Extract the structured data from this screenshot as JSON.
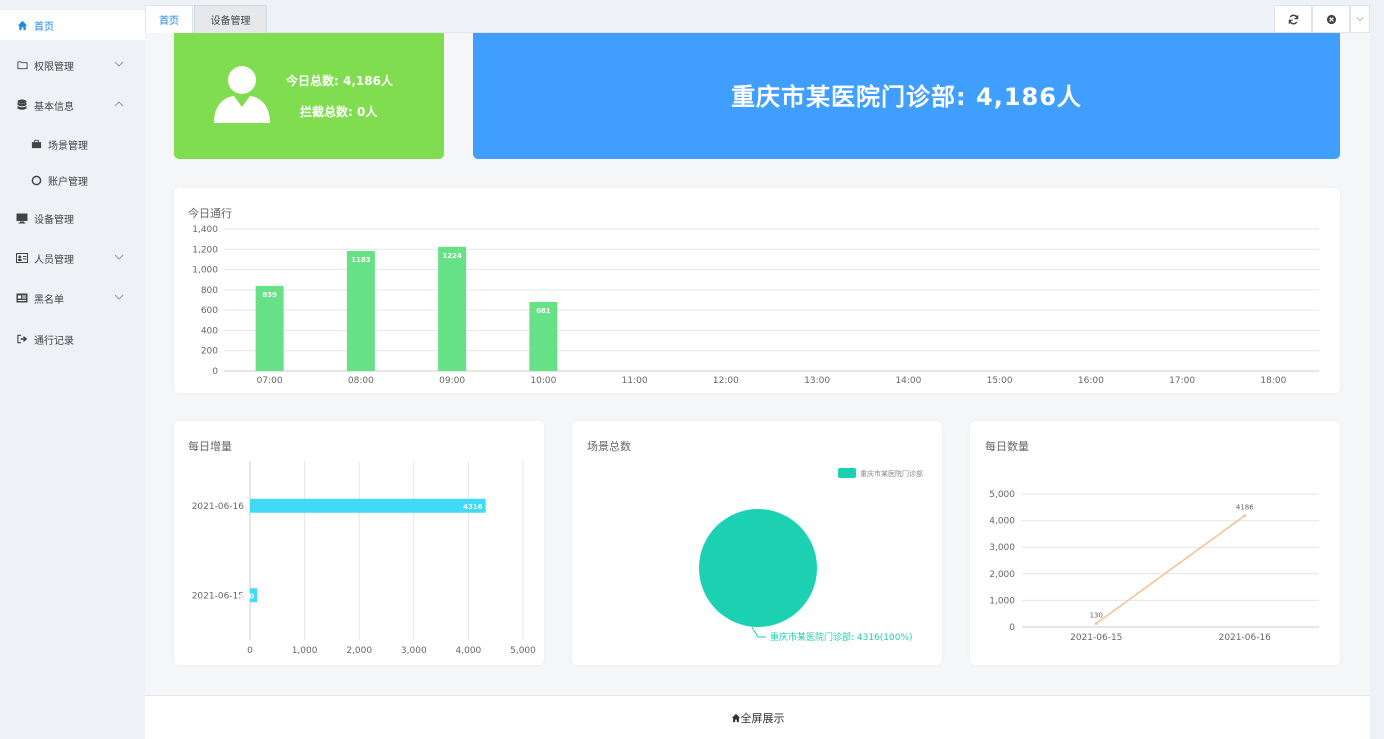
{
  "sidebar": {
    "items": [
      {
        "label": "首页",
        "icon": "home-icon",
        "active": true
      },
      {
        "label": "权限管理",
        "icon": "folder-icon",
        "expandable": true
      },
      {
        "label": "基本信息",
        "icon": "database-icon",
        "expanded": true
      },
      {
        "label": "场景管理",
        "icon": "briefcase-icon",
        "sub": true
      },
      {
        "label": "账户管理",
        "icon": "circle-icon",
        "sub": true
      },
      {
        "label": "设备管理",
        "icon": "monitor-icon"
      },
      {
        "label": "人员管理",
        "icon": "id-card-icon",
        "expandable": true
      },
      {
        "label": "黑名单",
        "icon": "list-card-icon",
        "expandable": true
      },
      {
        "label": "通行记录",
        "icon": "sign-out-icon"
      }
    ]
  },
  "tabs": [
    {
      "label": "首页",
      "active": true
    },
    {
      "label": "设备管理"
    }
  ],
  "stats": {
    "today_total": "今日总数:  4,186人",
    "blocked_total": "拦截总数:  0人",
    "headline": "重庆市某医院门诊部:  4,186人"
  },
  "colors": {
    "green": "#80dd50",
    "blue": "#409eff",
    "bar_green": "#67e186",
    "bar_cyan": "#40d9f7",
    "pie_teal": "#1bd1b1",
    "line_orange": "#f2c28e"
  },
  "footer": {
    "label": "全屏展示",
    "icon": "home-icon"
  },
  "chart_data": [
    {
      "type": "bar",
      "title": "今日通行",
      "categories": [
        "07:00",
        "08:00",
        "09:00",
        "10:00",
        "11:00",
        "12:00",
        "13:00",
        "14:00",
        "15:00",
        "16:00",
        "17:00",
        "18:00"
      ],
      "values": [
        839,
        1183,
        1224,
        681,
        null,
        null,
        null,
        null,
        null,
        null,
        null,
        null
      ],
      "yticks": [
        "0",
        "200",
        "400",
        "600",
        "800",
        "1,000",
        "1,200",
        "1,400"
      ],
      "ylim": [
        0,
        1400
      ],
      "grid": true
    },
    {
      "type": "bar",
      "orientation": "horizontal",
      "title": "每日增量",
      "categories": [
        "2021-06-16",
        "2021-06-15"
      ],
      "values": [
        4316,
        130
      ],
      "value_labels": [
        "4316",
        "130"
      ],
      "xticks": [
        "0",
        "1,000",
        "2,000",
        "3,000",
        "4,000",
        "5,000"
      ],
      "xlim": [
        0,
        5000
      ]
    },
    {
      "type": "pie",
      "title": "场景总数",
      "slices": [
        {
          "label": "重庆市某医院门诊部",
          "value": 4316,
          "percent": 100
        }
      ],
      "slice_label": "重庆市某医院门诊部: 4316(100%)",
      "legend": "top-right"
    },
    {
      "type": "line",
      "title": "每日数量",
      "x": [
        "2021-06-15",
        "2021-06-16"
      ],
      "values": [
        130,
        4186
      ],
      "point_labels": [
        "130",
        "4186"
      ],
      "yticks": [
        "0",
        "1,000",
        "2,000",
        "3,000",
        "4,000",
        "5,000"
      ],
      "ylim": [
        0,
        5000
      ]
    }
  ]
}
